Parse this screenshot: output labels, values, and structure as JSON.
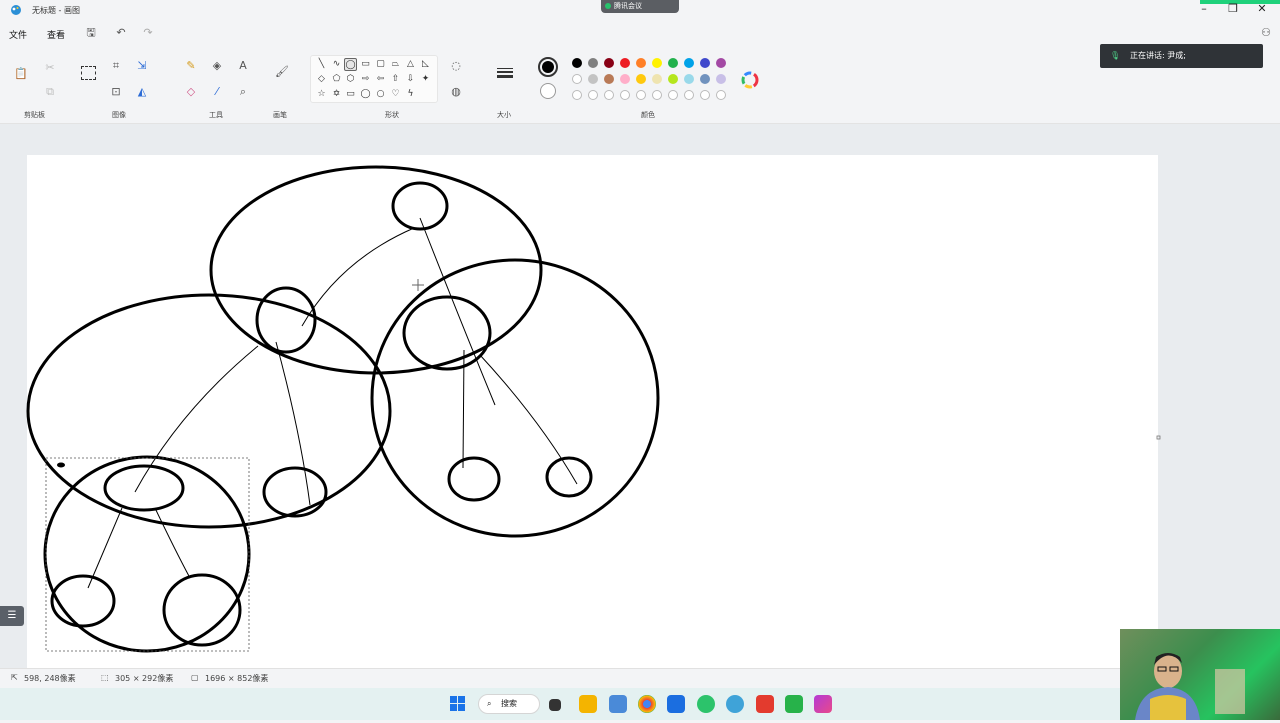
{
  "window": {
    "title": "无标题 - 画图",
    "meeting_tag": "腾讯会议"
  },
  "menu": {
    "file": "文件",
    "view": "查看"
  },
  "ribbon": {
    "groups": {
      "clipboard": "剪贴板",
      "image": "图像",
      "tools": "工具",
      "brushes": "画笔",
      "shapes": "形状",
      "size": "大小",
      "colors": "颜色"
    }
  },
  "colors": {
    "row1": [
      "#000000",
      "#7f7f7f",
      "#880015",
      "#ed1c24",
      "#ff7f27",
      "#fff200",
      "#22b14c",
      "#00a2e8",
      "#3f48cc",
      "#a349a4"
    ],
    "row2": [
      "#ffffff",
      "#c3c3c3",
      "#b97a57",
      "#ffaec9",
      "#ffc90e",
      "#efe4b0",
      "#b5e61d",
      "#99d9ea",
      "#7092be",
      "#c8bfe7"
    ],
    "primary": "#000000",
    "secondary": "#ffffff"
  },
  "speaking": {
    "label": "正在讲话: 尹成;"
  },
  "status": {
    "cursor": "598, 248像素",
    "selection": "305 × 292像素",
    "canvas_size": "1696 × 852像素"
  },
  "taskbar": {
    "search": "搜索"
  }
}
